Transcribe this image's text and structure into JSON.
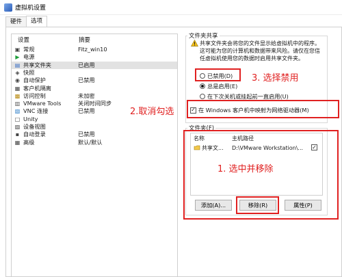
{
  "window": {
    "title": "虚拟机设置"
  },
  "tabs": [
    {
      "label": "硬件",
      "active": false
    },
    {
      "label": "选项",
      "active": true
    }
  ],
  "settings_list": {
    "header": {
      "col1": "设置",
      "col2": "摘要"
    },
    "items": [
      {
        "icon": "general-icon",
        "label": "常规",
        "value": "Fitz_win10",
        "selected": false
      },
      {
        "icon": "power-icon",
        "label": "电源",
        "value": "",
        "selected": false
      },
      {
        "icon": "shared-folders-icon",
        "label": "共享文件夹",
        "value": "已启用",
        "selected": true
      },
      {
        "icon": "snapshot-icon",
        "label": "快照",
        "value": "",
        "selected": false
      },
      {
        "icon": "autoprotect-icon",
        "label": "自动保护",
        "value": "已禁用",
        "selected": false
      },
      {
        "icon": "guest-isolation-icon",
        "label": "客户机隔离",
        "value": "",
        "selected": false
      },
      {
        "icon": "access-control-icon",
        "label": "访问控制",
        "value": "未加密",
        "selected": false
      },
      {
        "icon": "vmware-tools-icon",
        "label": "VMware Tools",
        "value": "关闭时间同步",
        "selected": false
      },
      {
        "icon": "vnc-icon",
        "label": "VNC 连接",
        "value": "已禁用",
        "selected": false
      },
      {
        "icon": "unity-icon",
        "label": "Unity",
        "value": "",
        "selected": false
      },
      {
        "icon": "appliance-view-icon",
        "label": "设备视图",
        "value": "",
        "selected": false
      },
      {
        "icon": "autologon-icon",
        "label": "自动登录",
        "value": "已禁用",
        "selected": false
      },
      {
        "icon": "advanced-icon",
        "label": "高级",
        "value": "默认/默认",
        "selected": false
      }
    ]
  },
  "folder_sharing": {
    "group_title": "文件夹共享",
    "description": "共享文件夹会将您的文件显示给虚拟机中的程序。这可能为您的计算机和数据带来风险。请仅在您信任虚拟机使用您的数据时启用共享文件夹。",
    "options": [
      {
        "label": "已禁用(D)",
        "checked": false
      },
      {
        "label": "总是启用(E)",
        "checked": true
      },
      {
        "label": "在下次关机或挂起前一直启用(U)",
        "checked": false
      }
    ],
    "map_drive": {
      "label": "在 Windows 客户机中映射为网络驱动器(M)",
      "checked": true
    }
  },
  "folders": {
    "group_title": "文件夹(F)",
    "columns": [
      "名称",
      "主机路径"
    ],
    "rows": [
      {
        "name": "共享文...",
        "path": "D:\\VMware Workstation\\...",
        "enabled": true
      }
    ],
    "buttons": {
      "add": "添加(A)...",
      "remove": "移除(R)",
      "properties": "属性(P)"
    }
  },
  "annotations": {
    "step1": "1. 选中并移除",
    "step2": "2.取消勾选",
    "step3": "3. 选择禁用",
    "color": "#e02020"
  }
}
